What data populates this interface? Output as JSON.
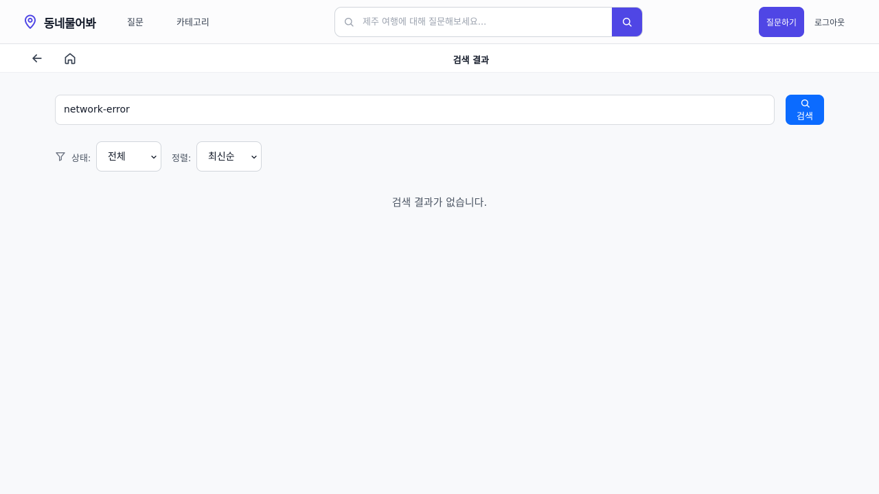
{
  "header": {
    "brand": "동네물어봐",
    "nav": {
      "questions": "질문",
      "categories": "카테고리"
    },
    "search_placeholder": "제주 여행에 대해 질문해보세요...",
    "ask_button": "질문하기",
    "logout": "로그아웃"
  },
  "subheader": {
    "title": "검색 결과"
  },
  "search": {
    "value": "network-error",
    "button_label": "검색"
  },
  "filters": {
    "status_label": "상태:",
    "status_value": "전체",
    "sort_label": "정렬:",
    "sort_value": "최신순"
  },
  "results": {
    "empty_message": "검색 결과가 없습니다."
  },
  "colors": {
    "brand": "#4f46e5",
    "primary_button": "#0b6bff"
  },
  "icons": [
    "map-pin-icon",
    "search-icon",
    "arrow-left-icon",
    "home-icon",
    "filter-icon",
    "chevron-down-icon"
  ]
}
